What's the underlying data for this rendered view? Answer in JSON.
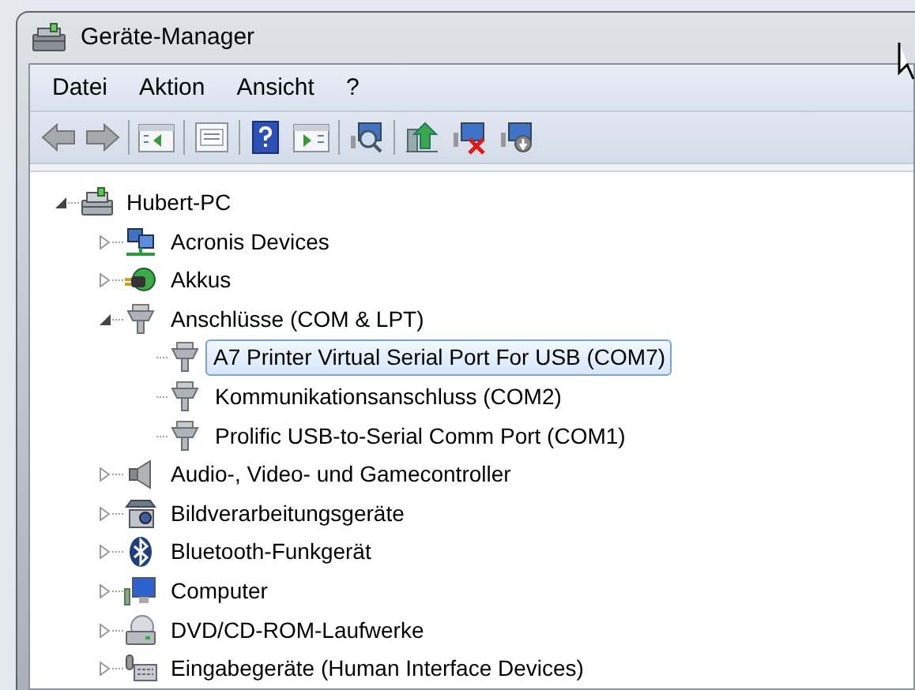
{
  "window": {
    "title": "Geräte-Manager"
  },
  "menu": [
    "Datei",
    "Aktion",
    "Ansicht",
    "?"
  ],
  "tree": [
    {
      "label": "Hubert-PC",
      "expanded": true,
      "selected": false,
      "children": [
        {
          "label": "Acronis Devices",
          "expanded": false,
          "selected": false
        },
        {
          "label": "Akkus",
          "expanded": false,
          "selected": false
        },
        {
          "label": "Anschlüsse (COM & LPT)",
          "expanded": true,
          "selected": false,
          "children": [
            {
              "label": "A7 Printer Virtual Serial Port For USB (COM7)",
              "selected": true
            },
            {
              "label": "Kommunikationsanschluss (COM2)",
              "selected": false
            },
            {
              "label": "Prolific USB-to-Serial Comm Port (COM1)",
              "selected": false
            }
          ]
        },
        {
          "label": "Audio-, Video- und Gamecontroller",
          "expanded": false,
          "selected": false
        },
        {
          "label": "Bildverarbeitungsgeräte",
          "expanded": false,
          "selected": false
        },
        {
          "label": "Bluetooth-Funkgerät",
          "expanded": false,
          "selected": false
        },
        {
          "label": "Computer",
          "expanded": false,
          "selected": false
        },
        {
          "label": "DVD/CD-ROM-Laufwerke",
          "expanded": false,
          "selected": false
        },
        {
          "label": "Eingabegeräte (Human Interface Devices)",
          "expanded": false,
          "selected": false
        }
      ]
    }
  ]
}
